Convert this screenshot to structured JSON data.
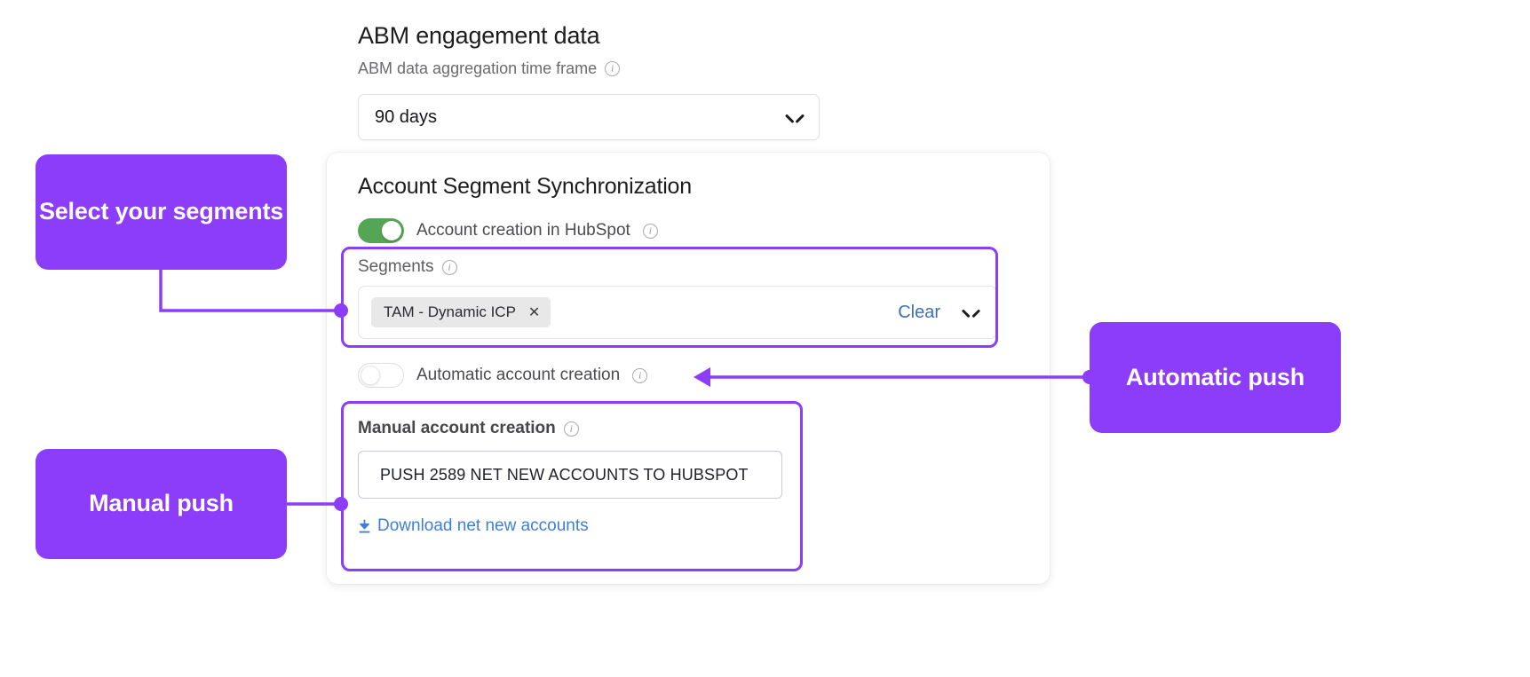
{
  "header": {
    "title": "ABM engagement data",
    "subtitle": "ABM data aggregation time frame",
    "info_icon": "info-icon"
  },
  "time_frame_select": {
    "value": "90 days",
    "chevron_icon": "chevron-down-icon"
  },
  "card": {
    "title": "Account Segment Synchronization",
    "hubspot_toggle": {
      "label": "Account creation in HubSpot",
      "state": "on",
      "color": "#55a654",
      "info_icon": "info-icon"
    },
    "segments": {
      "label": "Segments",
      "info_icon": "info-icon",
      "chips": [
        {
          "label": "TAM - Dynamic ICP",
          "remove_icon": "close-icon"
        }
      ],
      "clear_label": "Clear",
      "clear_color": "#3d6fb5",
      "chevron_icon": "chevron-down-icon"
    },
    "automatic_toggle": {
      "label": "Automatic account creation",
      "state": "off",
      "info_icon": "info-icon"
    },
    "manual": {
      "label": "Manual account creation",
      "info_icon": "info-icon",
      "push_button_label": "PUSH 2589 NET NEW ACCOUNTS TO HUBSPOT",
      "download_link_label": "Download net new accounts",
      "download_icon": "download-icon",
      "link_color": "#3f7fd4"
    }
  },
  "callouts": {
    "accent_color": "#8b3dfa",
    "segments": "Select your segments",
    "automatic": "Automatic push",
    "manual": "Manual push"
  }
}
